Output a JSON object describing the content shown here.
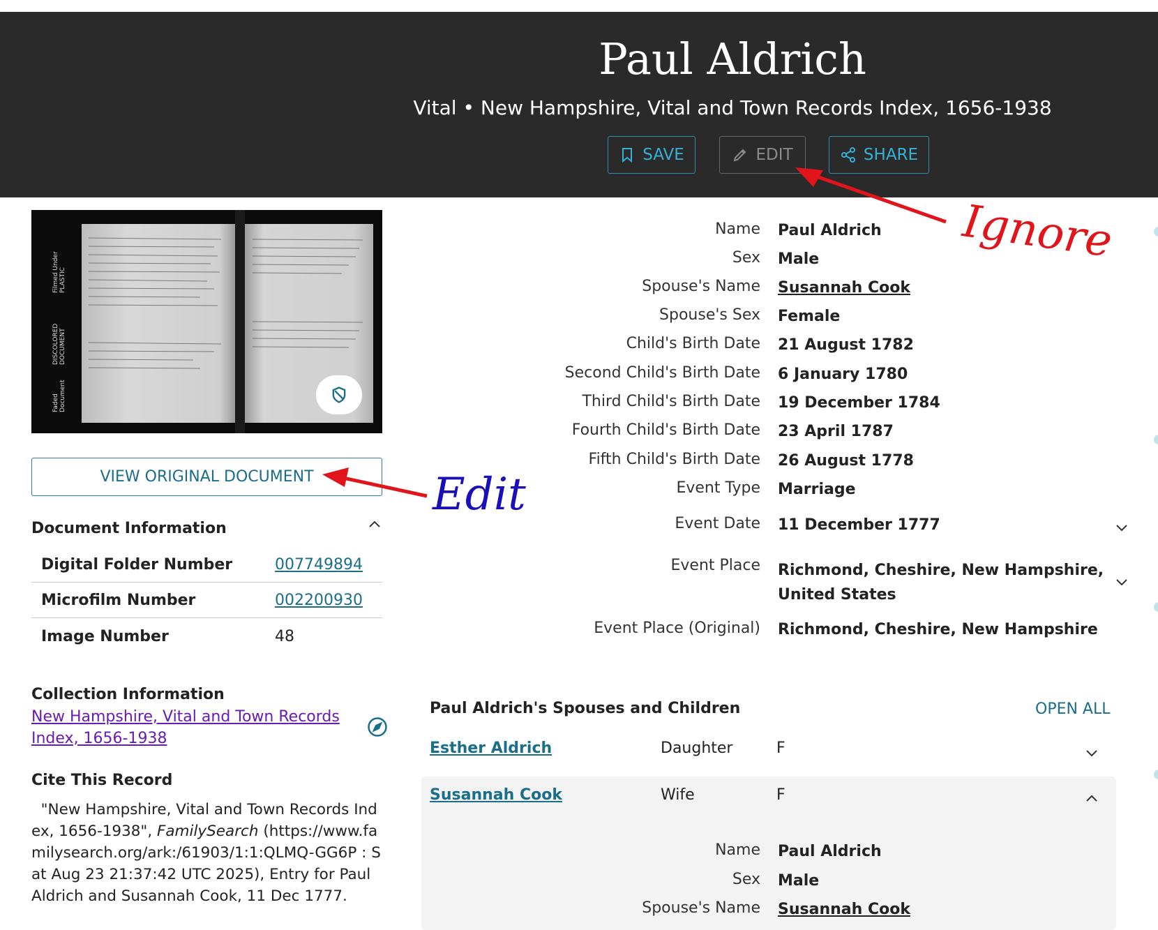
{
  "header": {
    "title": "Paul Aldrich",
    "subtitle": "Vital • New Hampshire, Vital and Town Records Index, 1656-1938",
    "save_label": "SAVE",
    "edit_label": "EDIT",
    "share_label": "SHARE"
  },
  "thumbnail": {
    "alt": "Record image",
    "side_labels": [
      "Faded Document",
      "DISCOLORED DOCUMENT",
      "Filmed Under PLASTIC"
    ]
  },
  "view_original_label": "VIEW ORIGINAL DOCUMENT",
  "document_info": {
    "heading": "Document Information",
    "rows": [
      {
        "label": "Digital Folder Number",
        "value": "007749894"
      },
      {
        "label": "Microfilm Number",
        "value": "002200930"
      },
      {
        "label": "Image Number",
        "value": "48"
      }
    ]
  },
  "collection_info": {
    "heading": "Collection Information",
    "link_line1": "New Hampshire, Vital and Town Records",
    "link_line2": "Index, 1656-1938"
  },
  "cite": {
    "heading": "Cite This Record",
    "text_before_italic": "\"New Hampshire, Vital and Town Records Index, 1656-1938\", ",
    "italic": "FamilySearch",
    "text_after_italic": " (https://www.familysearch.org/ark:/61903/1:1:QLMQ-GG6P : Sat Aug 23 21:37:42 UTC 2025), Entry for Paul Aldrich and Susannah Cook, 11 Dec 1777."
  },
  "details": [
    {
      "label": "Name",
      "value": "Paul Aldrich"
    },
    {
      "label": "Sex",
      "value": "Male"
    },
    {
      "label": "Spouse's Name",
      "value": "Susannah Cook"
    },
    {
      "label": "Spouse's Sex",
      "value": "Female"
    },
    {
      "label": "Child's Birth Date",
      "value": "21 August 1782"
    },
    {
      "label": "Second Child's Birth Date",
      "value": "6 January 1780"
    },
    {
      "label": "Third Child's Birth Date",
      "value": "19 December 1784"
    },
    {
      "label": "Fourth Child's Birth Date",
      "value": "23 April 1787"
    },
    {
      "label": "Fifth Child's Birth Date",
      "value": "26 August 1778"
    },
    {
      "label": "Event Type",
      "value": "Marriage"
    },
    {
      "label": "Event Date",
      "value": "11 December 1777"
    },
    {
      "label": "Event Place",
      "value_line1": "Richmond, Cheshire, New Hampshire,",
      "value_line2": "United States"
    },
    {
      "label": "Event Place (Original)",
      "value": "Richmond, Cheshire, New Hampshire"
    }
  ],
  "family": {
    "heading": "Paul Aldrich's Spouses and Children",
    "open_all_label": "OPEN ALL",
    "members": [
      {
        "name": "Esther Aldrich",
        "relationship": "Daughter",
        "sex": "F"
      },
      {
        "name": "Susannah Cook",
        "relationship": "Wife",
        "sex": "F"
      }
    ],
    "expanded": [
      {
        "label": "Name",
        "value": "Paul Aldrich"
      },
      {
        "label": "Sex",
        "value": "Male"
      },
      {
        "label": "Spouse's Name",
        "value": "Susannah Cook"
      }
    ]
  },
  "annotations": {
    "ignore_text": "Ignore",
    "edit_text": "Edit",
    "red": "#e0141b",
    "blue": "#1a10b8"
  },
  "colors": {
    "header_bg": "#2a2a2a",
    "accent": "#35b1d6",
    "link": "#1a6e8a",
    "visited": "#6a1bb0"
  }
}
